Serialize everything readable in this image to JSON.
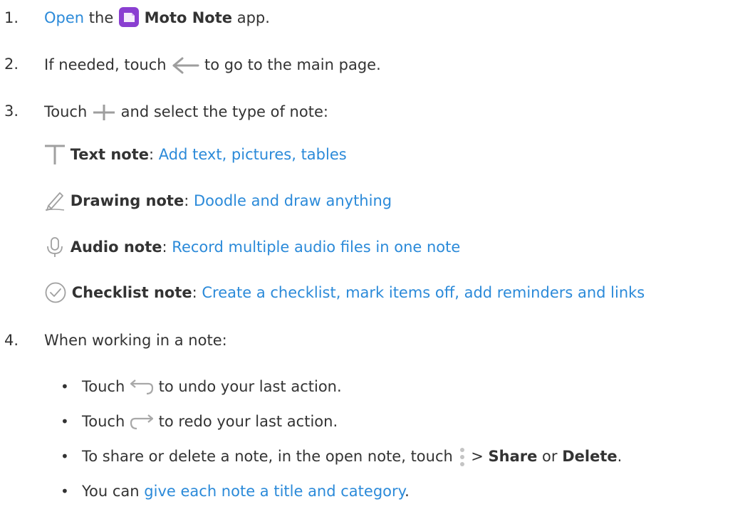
{
  "steps": [
    {
      "number": "1.",
      "open_link": "Open",
      "text_the": "the",
      "app_name": "Moto Note",
      "text_app": "app."
    },
    {
      "number": "2.",
      "text_before": "If needed, touch",
      "text_after": "to go to the main page."
    },
    {
      "number": "3.",
      "text_before": "Touch",
      "text_after": "and select the type of note:",
      "note_types": [
        {
          "icon": "text-t-icon",
          "name": "Text note",
          "sep": ":",
          "desc": "Add text, pictures, tables"
        },
        {
          "icon": "pencil-icon",
          "name": "Drawing note",
          "sep": ":",
          "desc": "Doodle and draw anything"
        },
        {
          "icon": "microphone-icon",
          "name": "Audio note",
          "sep": ":",
          "desc": "Record multiple audio files in one note"
        },
        {
          "icon": "check-circle-icon",
          "name": "Checklist note",
          "sep": ":",
          "desc": "Create a checklist, mark items off, add reminders and links"
        }
      ]
    },
    {
      "number": "4.",
      "text": "When working in a note:",
      "bullets": [
        {
          "bullet": "•",
          "before": "Touch",
          "after": "to undo your last action."
        },
        {
          "bullet": "•",
          "before": "Touch",
          "after": "to redo your last action."
        },
        {
          "bullet": "•",
          "before": "To share or delete a note, in the open note, touch",
          "gt": ">",
          "share": "Share",
          "or": "or",
          "delete": "Delete",
          "end": "."
        },
        {
          "bullet": "•",
          "before": "You can",
          "link": "give each note a title and category",
          "end": "."
        }
      ]
    }
  ],
  "colors": {
    "link": "#2b8ad9",
    "text": "#333333",
    "icon_gray": "#9e9e9e",
    "app_icon": "#8a3fd1"
  }
}
